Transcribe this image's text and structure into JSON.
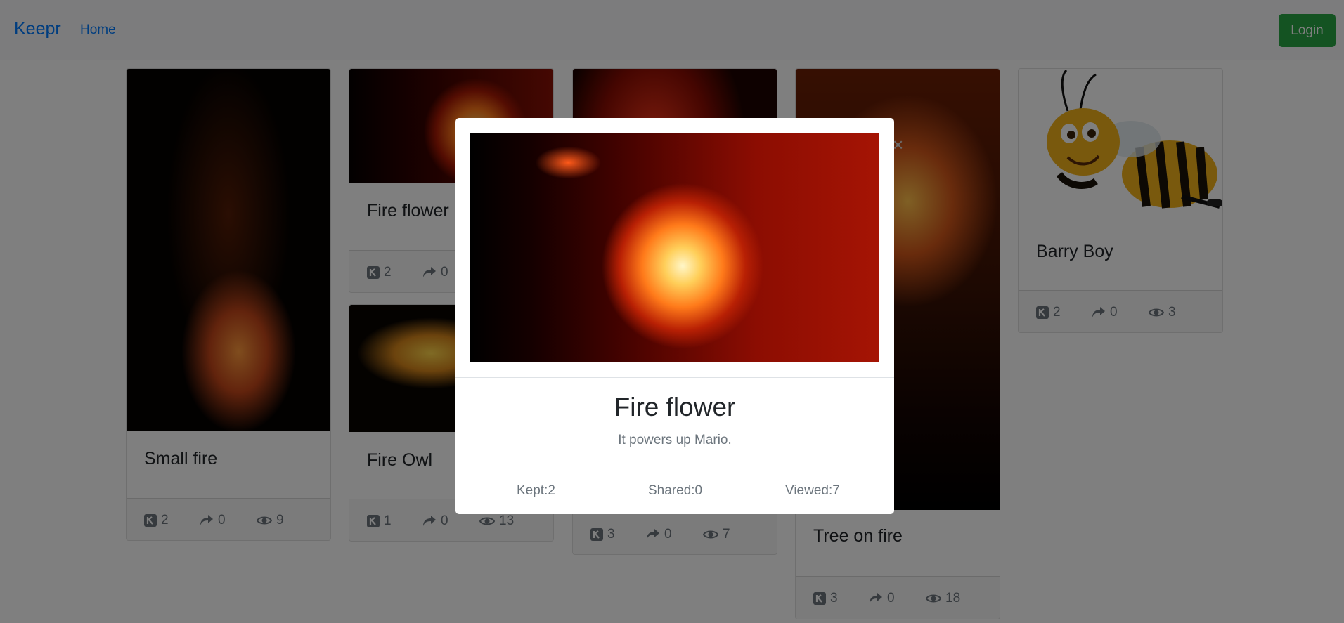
{
  "navbar": {
    "brand": "Keepr",
    "home_label": "Home",
    "login_label": "Login"
  },
  "cards": [
    {
      "title": "Small fire",
      "kept": "2",
      "shared": "0",
      "viewed": "9"
    },
    {
      "title": "Fire flower",
      "kept": "2",
      "shared": "0",
      "viewed": ""
    },
    {
      "title": "Fire Owl",
      "kept": "1",
      "shared": "0",
      "viewed": "13"
    },
    {
      "title": "",
      "kept": "3",
      "shared": "0",
      "viewed": "7"
    },
    {
      "title": "Tree on fire",
      "kept": "3",
      "shared": "0",
      "viewed": "18"
    },
    {
      "title": "Barry Boy",
      "kept": "2",
      "shared": "0",
      "viewed": "3"
    }
  ],
  "modal": {
    "title": "Fire flower",
    "description": "It powers up Mario.",
    "kept": "Kept:2",
    "shared": "Shared:0",
    "viewed": "Viewed:7",
    "close": "×"
  },
  "colors": {
    "brand": "#007bff",
    "login": "#28a745",
    "muted": "#6c757d"
  },
  "icons": [
    "keep-icon",
    "share-icon",
    "eye-icon",
    "close-icon"
  ]
}
